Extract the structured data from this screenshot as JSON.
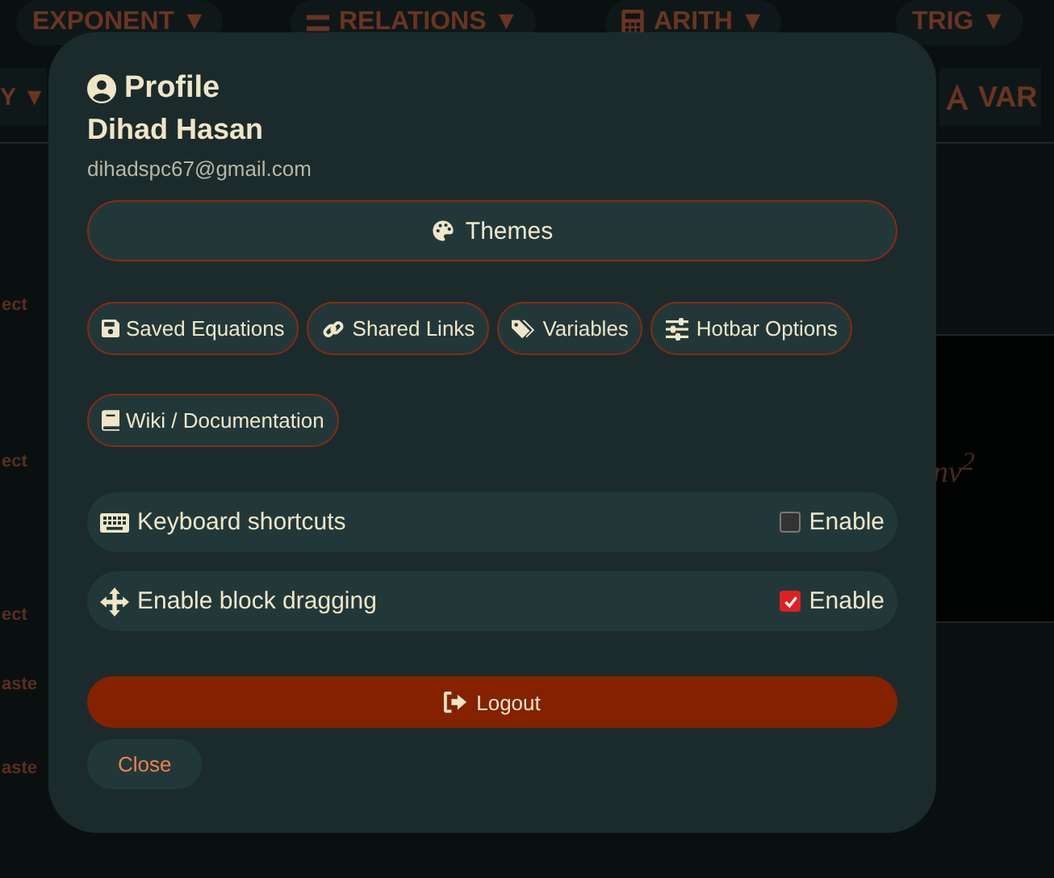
{
  "background": {
    "hotbar": [
      "EXPONENT ▼",
      "RELATIONS ▼",
      "ARITH ▼",
      "TRIG ▼"
    ],
    "hotbar_row_2": [
      "Y ▼",
      "VAR"
    ],
    "side_items": [
      "ect",
      "ect",
      "ect",
      "aste",
      "aste"
    ],
    "formula": "nv$^{2}$"
  },
  "profile": {
    "title": "Profile",
    "name": "Dihad Hasan",
    "email": "dihadspc67@gmail.com",
    "themes_button": "Themes",
    "links": [
      "Saved Equations",
      "Shared Links",
      "Variables",
      "Hotbar Options",
      "Wiki / Documentation"
    ],
    "settings": [
      {
        "label": "Keyboard shortcuts",
        "checkbox_label": "Enable",
        "checked": false
      },
      {
        "label": "Enable block dragging",
        "checkbox_label": "Enable",
        "checked": true
      }
    ],
    "logout_button": "Logout",
    "close_button": "Close"
  }
}
